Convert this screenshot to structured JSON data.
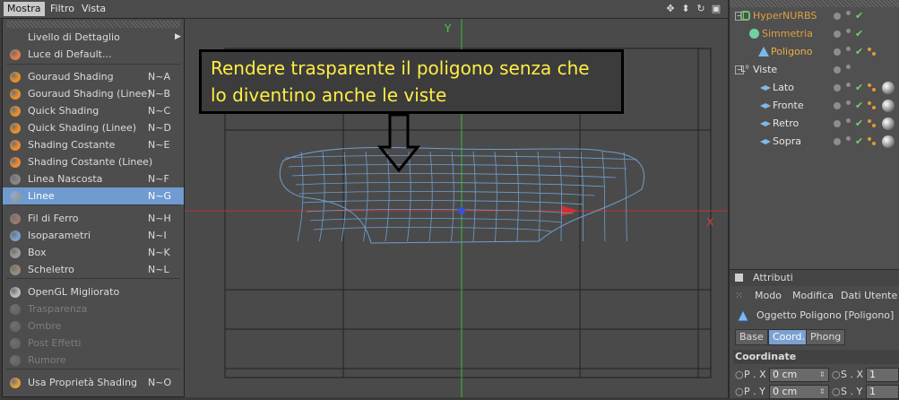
{
  "menubar": {
    "items": [
      {
        "label": "Mostra",
        "active": true
      },
      {
        "label": "Filtro",
        "active": false
      },
      {
        "label": "Vista",
        "active": false
      }
    ],
    "nav_icons": [
      "move-icon",
      "zoom-icon",
      "rotate-icon",
      "maximize-icon"
    ]
  },
  "dropdown": {
    "items": [
      {
        "label": "Livello di Dettaglio",
        "shortcut": "",
        "submenu": true,
        "icon": "none"
      },
      {
        "label": "Luce di Default...",
        "shortcut": "",
        "icon": "light-icon"
      },
      {
        "label": "Gouraud Shading",
        "shortcut": "N~A",
        "icon": "gouraud-icon"
      },
      {
        "label": "Gouraud Shading (Linee)",
        "shortcut": "N~B",
        "icon": "gouraud-lines-icon"
      },
      {
        "label": "Quick Shading",
        "shortcut": "N~C",
        "icon": "quick-icon"
      },
      {
        "label": "Quick Shading (Linee)",
        "shortcut": "N~D",
        "icon": "quick-lines-icon"
      },
      {
        "label": "Shading Costante",
        "shortcut": "N~E",
        "icon": "constant-icon"
      },
      {
        "label": "Shading Costante (Linee)",
        "shortcut": "",
        "icon": "constant-lines-icon"
      },
      {
        "label": "Linea Nascosta",
        "shortcut": "N~F",
        "icon": "hidden-line-icon"
      },
      {
        "label": "Linee",
        "shortcut": "N~G",
        "icon": "lines-icon",
        "selected": true
      },
      {
        "label": "Fil di Ferro",
        "shortcut": "N~H",
        "icon": "wireframe-icon"
      },
      {
        "label": "Isoparametri",
        "shortcut": "N~I",
        "icon": "isoparm-icon"
      },
      {
        "label": "Box",
        "shortcut": "N~K",
        "icon": "box-icon"
      },
      {
        "label": "Scheletro",
        "shortcut": "N~L",
        "icon": "skeleton-icon"
      },
      {
        "label": "OpenGL Migliorato",
        "shortcut": "",
        "icon": "opengl-icon"
      },
      {
        "label": "Trasparenza",
        "shortcut": "",
        "icon": "transparency-icon",
        "disabled": true
      },
      {
        "label": "Ombre",
        "shortcut": "",
        "icon": "shadows-icon",
        "disabled": true
      },
      {
        "label": "Post Effetti",
        "shortcut": "",
        "icon": "post-effects-icon",
        "disabled": true
      },
      {
        "label": "Rumore",
        "shortcut": "",
        "icon": "noise-icon",
        "disabled": true
      },
      {
        "label": "Usa Proprietà Shading",
        "shortcut": "N~O",
        "icon": "eye-icon"
      }
    ]
  },
  "viewport": {
    "axis_y": "Y",
    "axis_x": "X",
    "annotation_line1": "Rendere trasparente il poligono senza che",
    "annotation_line2": "lo diventino anche le viste"
  },
  "object_manager": {
    "objects": [
      {
        "name": "HyperNURBS",
        "color": "#e0a040"
      },
      {
        "name": "Simmetria",
        "color": "#e0a040"
      },
      {
        "name": "Poligono",
        "color": "#f0b040"
      },
      {
        "name": "Viste",
        "color": "#e6e6e6"
      },
      {
        "name": "Lato",
        "color": "#e6e6e6"
      },
      {
        "name": "Fronte",
        "color": "#e6e6e6"
      },
      {
        "name": "Retro",
        "color": "#e6e6e6"
      },
      {
        "name": "Sopra",
        "color": "#e6e6e6"
      }
    ]
  },
  "attributes": {
    "title": "Attributi",
    "menu": [
      "Modo",
      "Modifica",
      "Dati Utente"
    ],
    "object_label": "Oggetto Poligono [Poligono]",
    "tabs": [
      {
        "label": "Base",
        "active": false
      },
      {
        "label": "Coord.",
        "active": true
      },
      {
        "label": "Phong",
        "active": false
      }
    ],
    "section": "Coordinate",
    "fields": [
      {
        "label": "P . X",
        "value": "0 cm",
        "s_label": "S . X",
        "s_value": "1"
      },
      {
        "label": "P . Y",
        "value": "0 cm",
        "s_label": "S . Y",
        "s_value": "1"
      }
    ]
  }
}
